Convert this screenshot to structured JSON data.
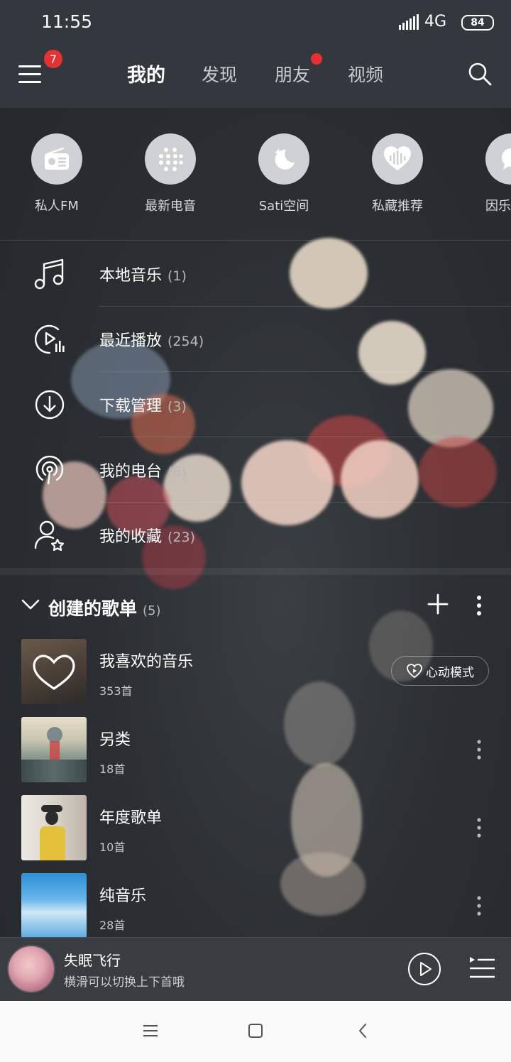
{
  "status_bar": {
    "time": "11:55",
    "network": "4G",
    "battery": "84"
  },
  "nav": {
    "menu_badge": "7",
    "tabs": [
      {
        "label": "我的",
        "active": true
      },
      {
        "label": "发现",
        "active": false
      },
      {
        "label": "朋友",
        "active": false
      },
      {
        "label": "视频",
        "active": false
      }
    ]
  },
  "quick_access": [
    {
      "label": "私人FM",
      "icon": "radio-icon"
    },
    {
      "label": "最新电音",
      "icon": "dots-grid-icon"
    },
    {
      "label": "Sati空间",
      "icon": "moon-icon"
    },
    {
      "label": "私藏推荐",
      "icon": "heart-wave-icon"
    },
    {
      "label": "因乐",
      "icon": "chat-icon"
    }
  ],
  "menu_list": [
    {
      "label": "本地音乐",
      "count": "(1)",
      "icon": "music-note-icon"
    },
    {
      "label": "最近播放",
      "count": "(254)",
      "icon": "recent-play-icon"
    },
    {
      "label": "下载管理",
      "count": "(3)",
      "icon": "download-icon"
    },
    {
      "label": "我的电台",
      "count": "(6)",
      "icon": "podcast-icon"
    },
    {
      "label": "我的收藏",
      "count": "(23)",
      "icon": "user-star-icon"
    }
  ],
  "playlists": {
    "title": "创建的歌单",
    "count": "(5)",
    "items": [
      {
        "name": "我喜欢的音乐",
        "count": "353首",
        "heart_mode_label": "心动模式"
      },
      {
        "name": "另类",
        "count": "18首"
      },
      {
        "name": "年度歌单",
        "count": "10首"
      },
      {
        "name": "纯音乐",
        "count": "28首"
      }
    ]
  },
  "player": {
    "song": "失眠飞行",
    "hint": "横滑可以切换上下首哦"
  },
  "colors": {
    "accent_red": "#e8312f",
    "nav_bg": "#343a40"
  }
}
